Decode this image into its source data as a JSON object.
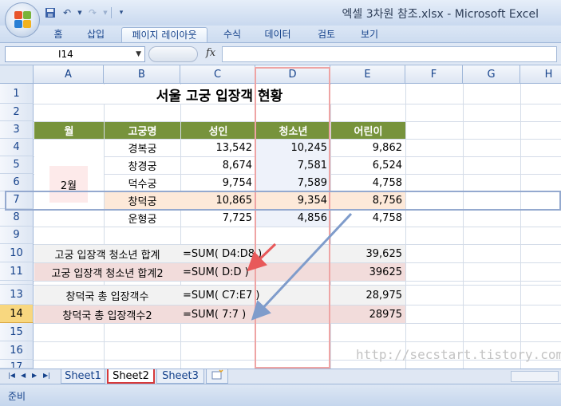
{
  "window": {
    "title": "엑셀 3차원 참조.xlsx - Microsoft Excel"
  },
  "ribbon_tabs": [
    "홈",
    "삽입",
    "페이지 레이아웃",
    "수식",
    "데이터",
    "검토",
    "보기"
  ],
  "formula_bar": {
    "name_box": "I14",
    "fx_label": "fx",
    "formula": ""
  },
  "columns": [
    "A",
    "B",
    "C",
    "D",
    "E",
    "F",
    "G",
    "H"
  ],
  "rows": [
    "1",
    "2",
    "3",
    "4",
    "5",
    "6",
    "7",
    "8",
    "9",
    "10",
    "11",
    "13",
    "14",
    "15",
    "16",
    "17"
  ],
  "sheet": {
    "title": "서울 고궁 입장객 현황",
    "headers": [
      "월",
      "고궁명",
      "성인",
      "청소년",
      "어린이"
    ],
    "month": "2월",
    "data": [
      [
        "경복궁",
        "13,542",
        "10,245",
        "9,862"
      ],
      [
        "창경궁",
        "8,674",
        "7,581",
        "6,524"
      ],
      [
        "덕수궁",
        "9,754",
        "7,589",
        "4,758"
      ],
      [
        "창덕궁",
        "10,865",
        "9,354",
        "8,756"
      ],
      [
        "운형궁",
        "7,725",
        "4,856",
        "4,758"
      ]
    ],
    "summary": [
      {
        "label": "고궁 입장객 청소년 합계",
        "formula": "=SUM( D4:D8 )",
        "value": "39,625"
      },
      {
        "label": "고궁 입장객 청소년 합계2",
        "formula": "=SUM( D:D )",
        "value": "39625"
      },
      {
        "label": "창덕국 총 입장객수",
        "formula": "=SUM( C7:E7 )",
        "value": "28,975"
      },
      {
        "label": "창덕국 총 입장객수2",
        "formula": "=SUM( 7:7 )",
        "value": "28975"
      }
    ]
  },
  "sheet_tabs": [
    "Sheet1",
    "Sheet2",
    "Sheet3"
  ],
  "status": "준비",
  "watermark": "http://secstart.tistory.com",
  "colors": {
    "header_green": "#77933c",
    "row7_highlight": "#fde9d9",
    "pink_row": "#f2dcdb",
    "gray_row": "#f2f2f2",
    "red_annotation": "#e8595a",
    "blue_annotation": "#7f9ccb"
  }
}
